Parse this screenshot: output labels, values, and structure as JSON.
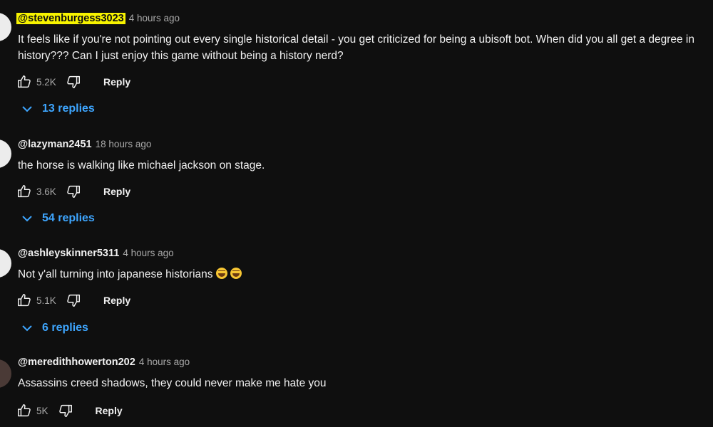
{
  "comments": [
    {
      "handle": "@stevenburgess3023",
      "time": "4 hours ago",
      "text": "It feels like if you're not pointing out every single historical detail - you get criticized for being a ubisoft bot. When did you all get a degree in history??? Can I just enjoy this game without being a history nerd?",
      "likes": "5.2K",
      "reply_label": "Reply",
      "replies_label": "13 replies"
    },
    {
      "handle": "@lazyman2451",
      "time": "18 hours ago",
      "text": "the horse is walking like michael jackson on stage.",
      "likes": "3.6K",
      "reply_label": "Reply",
      "replies_label": "54 replies"
    },
    {
      "handle": "@ashleyskinner5311",
      "time": "4 hours ago",
      "text": "Not y'all turning into japanese historians",
      "emoji": [
        "face-with-tears-of-joy",
        "face-with-tears-of-joy"
      ],
      "likes": "5.1K",
      "reply_label": "Reply",
      "replies_label": "6 replies"
    },
    {
      "handle": "@meredithhowerton202",
      "time": "4 hours ago",
      "text": "Assassins creed shadows, they could never make me hate you",
      "likes": "5K",
      "reply_label": "Reply"
    }
  ],
  "colors": {
    "background": "#0f0f0f",
    "highlight": "#f7f300",
    "link": "#3ea6ff",
    "secondary_text": "#aaaaaa"
  },
  "icons": [
    "thumbs-up-icon",
    "thumbs-down-icon",
    "chevron-down-icon",
    "avatar"
  ]
}
